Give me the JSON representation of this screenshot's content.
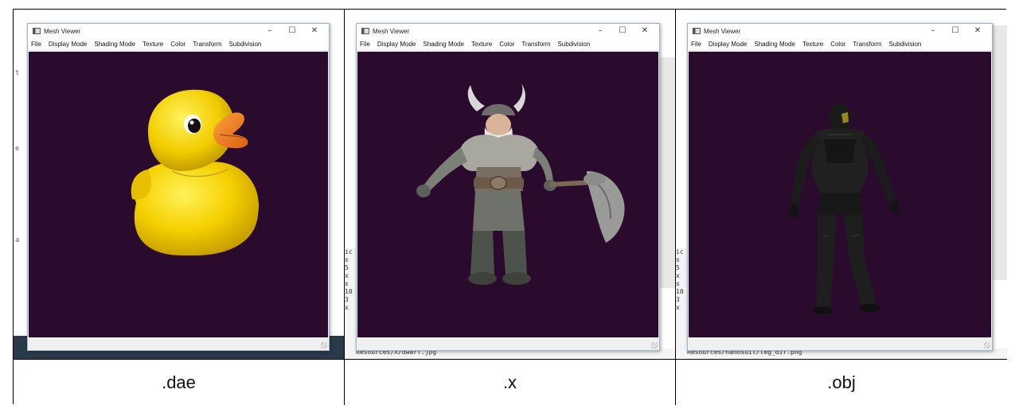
{
  "panels": [
    {
      "window_title": "Mesh Viewer",
      "menu": [
        "File",
        "Display Mode",
        "Shading Mode",
        "Texture",
        "Color",
        "Transform",
        "Subdivision"
      ],
      "controls": {
        "minimize": "–",
        "maximize": "☐",
        "close": "✕"
      },
      "model": "rubber-duck",
      "caption": ".dae"
    },
    {
      "window_title": "Mesh Viewer",
      "menu": [
        "File",
        "Display Mode",
        "Shading Mode",
        "Texture",
        "Color",
        "Transform",
        "Subdivision"
      ],
      "controls": {
        "minimize": "–",
        "maximize": "☐",
        "close": "✕"
      },
      "model": "dwarf-with-axe",
      "console_text": "Resources/X/dwarf.jpg",
      "caption": ".x"
    },
    {
      "window_title": "Mesh Viewer",
      "menu": [
        "File",
        "Display Mode",
        "Shading Mode",
        "Texture",
        "Color",
        "Transform",
        "Subdivision"
      ],
      "controls": {
        "minimize": "–",
        "maximize": "☐",
        "close": "✕"
      },
      "model": "nanosuit-soldier",
      "console_text": "Resources/nanosuit/leg_dif.png",
      "caption": ".obj"
    }
  ],
  "colors": {
    "viewport_background": "#2a0b2e",
    "duck_yellow": "#f5d000",
    "duck_beak": "#f07a1a"
  }
}
